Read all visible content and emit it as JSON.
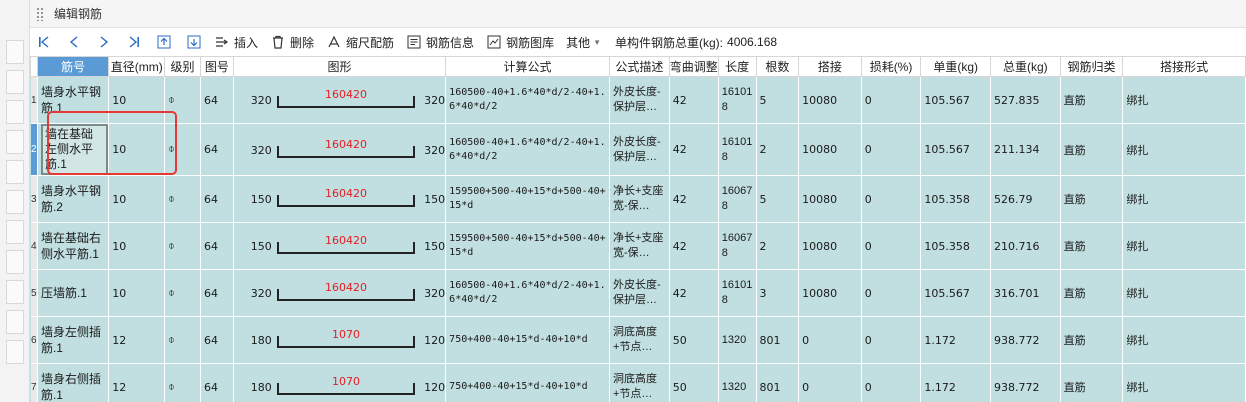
{
  "window": {
    "title": "编辑钢筋"
  },
  "toolbar": {
    "nav_icons": [
      "first-record-icon",
      "prev-record-icon",
      "next-record-icon",
      "last-record-icon",
      "move-up-icon",
      "move-down-icon"
    ],
    "insert_label": "插入",
    "delete_label": "删除",
    "scale_label": "缩尺配筋",
    "info_label": "钢筋信息",
    "library_label": "钢筋图库",
    "other_label": "其他",
    "total_label": "单构件钢筋总重(kg):",
    "total_value": "4006.168"
  },
  "table": {
    "columns": [
      "筋号",
      "直径(mm)",
      "级别",
      "图号",
      "图形",
      "计算公式",
      "公式描述",
      "弯曲调整",
      "长度",
      "根数",
      "搭接",
      "损耗(%)",
      "单重(kg)",
      "总重(kg)",
      "钢筋归类",
      "搭接形式"
    ],
    "grade_symbol": "⌽",
    "rows": [
      {
        "idx": "1",
        "name": "墙身水平钢筋.1",
        "dia": "10",
        "fig": "64",
        "left": "320",
        "mid": "160420",
        "right": "320",
        "formula": "160500-40+1.6*40*d/2-40+1.6*40*d/2",
        "desc": "外皮长度-保护层…",
        "bend": "42",
        "len": "161018",
        "count": "5",
        "lap": "10080",
        "loss": "0",
        "unit": "105.567",
        "total": "527.835",
        "cat": "直筋",
        "lapform": "绑扎"
      },
      {
        "idx": "2",
        "name": "墙在基础左侧水平筋.1",
        "dia": "10",
        "fig": "64",
        "left": "320",
        "mid": "160420",
        "right": "320",
        "formula": "160500-40+1.6*40*d/2-40+1.6*40*d/2",
        "desc": "外皮长度-保护层…",
        "bend": "42",
        "len": "161018",
        "count": "2",
        "lap": "10080",
        "loss": "0",
        "unit": "105.567",
        "total": "211.134",
        "cat": "直筋",
        "lapform": "绑扎"
      },
      {
        "idx": "3",
        "name": "墙身水平钢筋.2",
        "dia": "10",
        "fig": "64",
        "left": "150",
        "mid": "160420",
        "right": "150",
        "formula": "159500+500-40+15*d+500-40+15*d",
        "desc": "净长+支座宽-保…",
        "bend": "42",
        "len": "160678",
        "count": "5",
        "lap": "10080",
        "loss": "0",
        "unit": "105.358",
        "total": "526.79",
        "cat": "直筋",
        "lapform": "绑扎"
      },
      {
        "idx": "4",
        "name": "墙在基础右侧水平筋.1",
        "dia": "10",
        "fig": "64",
        "left": "150",
        "mid": "160420",
        "right": "150",
        "formula": "159500+500-40+15*d+500-40+15*d",
        "desc": "净长+支座宽-保…",
        "bend": "42",
        "len": "160678",
        "count": "2",
        "lap": "10080",
        "loss": "0",
        "unit": "105.358",
        "total": "210.716",
        "cat": "直筋",
        "lapform": "绑扎"
      },
      {
        "idx": "5",
        "name": "压墙筋.1",
        "dia": "10",
        "fig": "64",
        "left": "320",
        "mid": "160420",
        "right": "320",
        "formula": "160500-40+1.6*40*d/2-40+1.6*40*d/2",
        "desc": "外皮长度-保护层…",
        "bend": "42",
        "len": "161018",
        "count": "3",
        "lap": "10080",
        "loss": "0",
        "unit": "105.567",
        "total": "316.701",
        "cat": "直筋",
        "lapform": "绑扎"
      },
      {
        "idx": "6",
        "name": "墙身左侧插筋.1",
        "dia": "12",
        "fig": "64",
        "left": "180",
        "mid": "1070",
        "right": "120",
        "formula": "750+400-40+15*d-40+10*d",
        "desc": "洞底高度+节点…",
        "bend": "50",
        "len": "1320",
        "count": "801",
        "lap": "0",
        "loss": "0",
        "unit": "1.172",
        "total": "938.772",
        "cat": "直筋",
        "lapform": "绑扎"
      },
      {
        "idx": "7",
        "name": "墙身右侧插筋.1",
        "dia": "12",
        "fig": "64",
        "left": "180",
        "mid": "1070",
        "right": "120",
        "formula": "750+400-40+15*d-40+10*d",
        "desc": "洞底高度+节点…",
        "bend": "50",
        "len": "1320",
        "count": "801",
        "lap": "0",
        "loss": "0",
        "unit": "1.172",
        "total": "938.772",
        "cat": "直筋",
        "lapform": "绑扎"
      }
    ]
  }
}
